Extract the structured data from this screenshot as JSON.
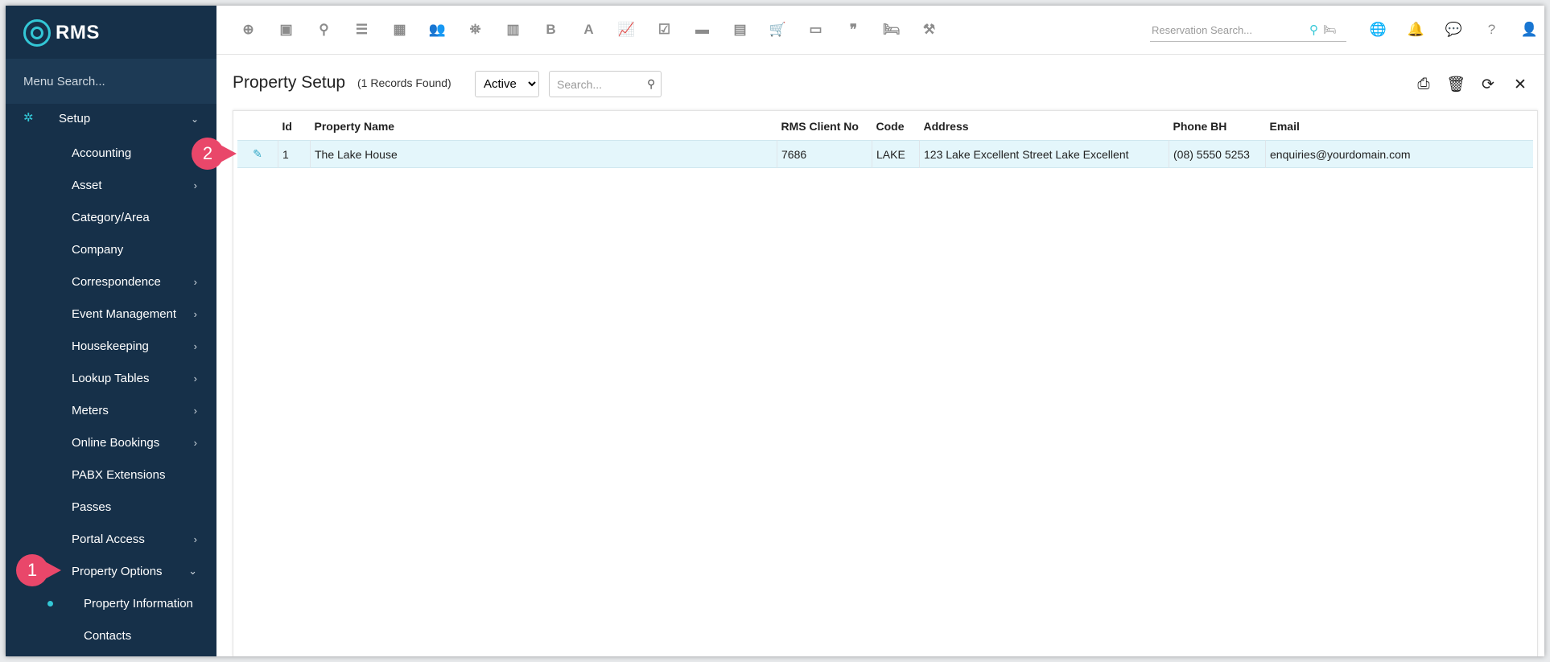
{
  "app": {
    "logo_text": "RMS"
  },
  "sidebar": {
    "search_placeholder": "Menu Search...",
    "section_label": "Setup",
    "items": [
      {
        "label": "Accounting",
        "has_children": false
      },
      {
        "label": "Asset",
        "has_children": true
      },
      {
        "label": "Category/Area",
        "has_children": false
      },
      {
        "label": "Company",
        "has_children": false
      },
      {
        "label": "Correspondence",
        "has_children": true
      },
      {
        "label": "Event Management",
        "has_children": true
      },
      {
        "label": "Housekeeping",
        "has_children": true
      },
      {
        "label": "Lookup Tables",
        "has_children": true
      },
      {
        "label": "Meters",
        "has_children": true
      },
      {
        "label": "Online Bookings",
        "has_children": true
      },
      {
        "label": "PABX Extensions",
        "has_children": false
      },
      {
        "label": "Passes",
        "has_children": false
      },
      {
        "label": "Portal Access",
        "has_children": true
      },
      {
        "label": "Property Options",
        "expanded": true
      }
    ],
    "sub_items": [
      {
        "label": "Property Information",
        "active": true
      },
      {
        "label": "Contacts"
      }
    ]
  },
  "toolbar": {
    "reservation_search_placeholder": "Reservation Search...",
    "bold_glyph": "B",
    "font_glyph": "A",
    "quote_glyph": "❞"
  },
  "page": {
    "title": "Property Setup",
    "records_found": "(1 Records Found)",
    "status_filter": "Active",
    "status_options": [
      "Active"
    ],
    "grid_search_placeholder": "Search..."
  },
  "table": {
    "columns": [
      "Id",
      "Property Name",
      "RMS Client No",
      "Code",
      "Address",
      "Phone BH",
      "Email"
    ],
    "rows": [
      {
        "id": "1",
        "property_name": "The Lake House",
        "rms_client_no": "7686",
        "code": "LAKE",
        "address": "123 Lake Excellent Street Lake Excellent",
        "phone_bh": "(08) 5550 5253",
        "email": "enquiries@yourdomain.com"
      }
    ]
  },
  "callouts": {
    "one": "1",
    "two": "2"
  },
  "colors": {
    "sidebar_bg": "#163049",
    "accent": "#33c7d6",
    "callout": "#e9476a",
    "row_highlight": "#e4f6fb",
    "user_icon": "#1a4fc8"
  }
}
